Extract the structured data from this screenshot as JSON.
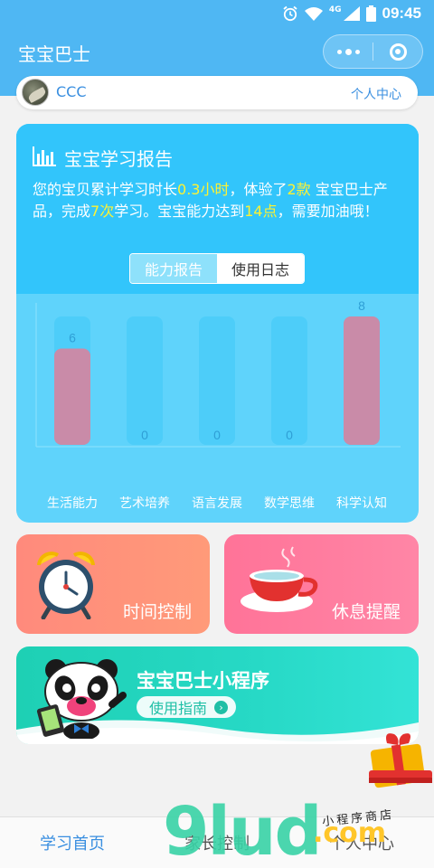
{
  "status": {
    "time": "09:45",
    "network": "4G"
  },
  "nav": {
    "title": "宝宝巴士"
  },
  "profile": {
    "name": "CCC",
    "center_link": "个人中心"
  },
  "report": {
    "title": "宝宝学习报告",
    "desc": {
      "p1": "您的宝贝累计学习时长",
      "hours": "0.3小时",
      "p2": "，体验了",
      "apps": "2款",
      "p3": " 宝宝巴士产品，完成",
      "times": "7次",
      "p4": "学习。宝宝能力达到",
      "points": "14点",
      "p5": "，需要加油哦！"
    },
    "tabs": [
      "能力报告",
      "使用日志"
    ]
  },
  "chart_data": {
    "type": "bar",
    "categories": [
      "生活能力",
      "艺术培养",
      "语言发展",
      "数学思维",
      "科学认知"
    ],
    "values": [
      6,
      0,
      0,
      0,
      8
    ],
    "ylim": [
      0,
      8
    ],
    "bar_color": "#c98ba8",
    "track_color": "#4dcdf9",
    "label_color": "#2f9fd6",
    "grid": false
  },
  "tiles": {
    "time_control": "时间控制",
    "rest_reminder": "休息提醒"
  },
  "banner": {
    "title": "宝宝巴士小程序",
    "button": "使用指南"
  },
  "bottom_nav": {
    "home": "学习首页",
    "parent": "家长控制",
    "me": "个人中心"
  },
  "watermark": {
    "logo": "9lud",
    "suffix": ".com",
    "shop": "小程序商店"
  }
}
